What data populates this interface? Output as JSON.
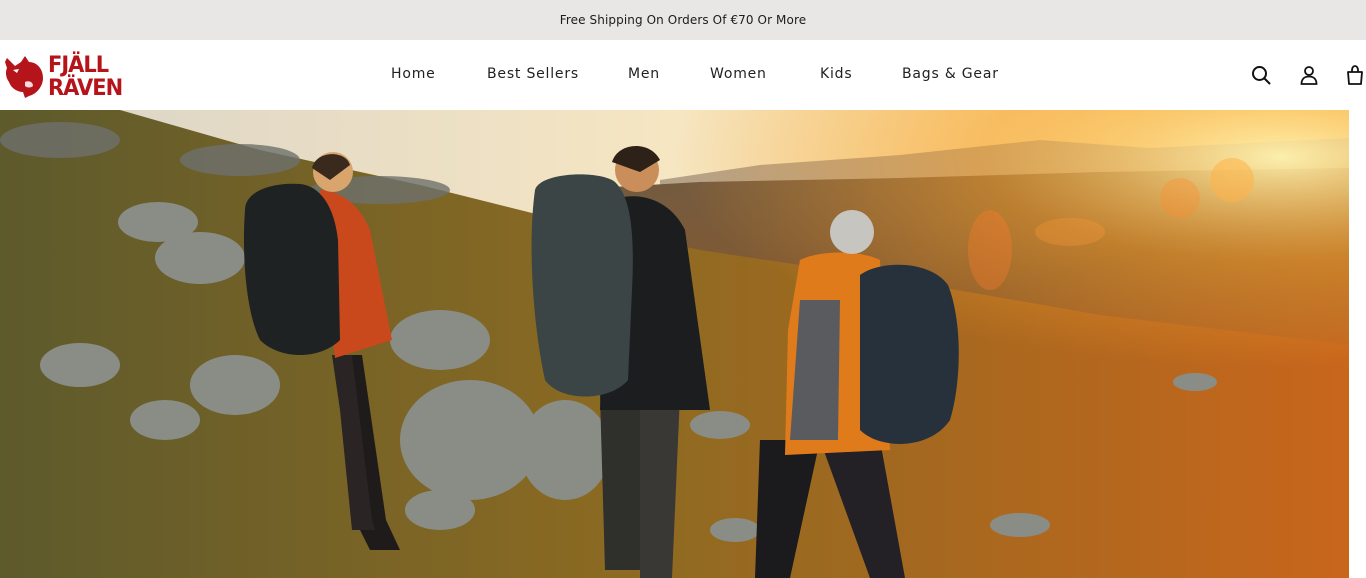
{
  "announcement": {
    "text": "Free Shipping On Orders Of €70 Or More"
  },
  "brand": {
    "logo_line1": "FJÄLL",
    "logo_line2": "RÄVEN",
    "color": "#b5141a"
  },
  "nav": {
    "items": [
      {
        "label": "Home"
      },
      {
        "label": "Best Sellers"
      },
      {
        "label": "Men"
      },
      {
        "label": "Women"
      },
      {
        "label": "Kids"
      },
      {
        "label": "Bags & Gear"
      }
    ]
  },
  "header_icons": [
    "search-icon",
    "account-icon",
    "cart-icon"
  ],
  "hero": {
    "image": "hikers-on-autumn-mountain-at-sunset"
  }
}
